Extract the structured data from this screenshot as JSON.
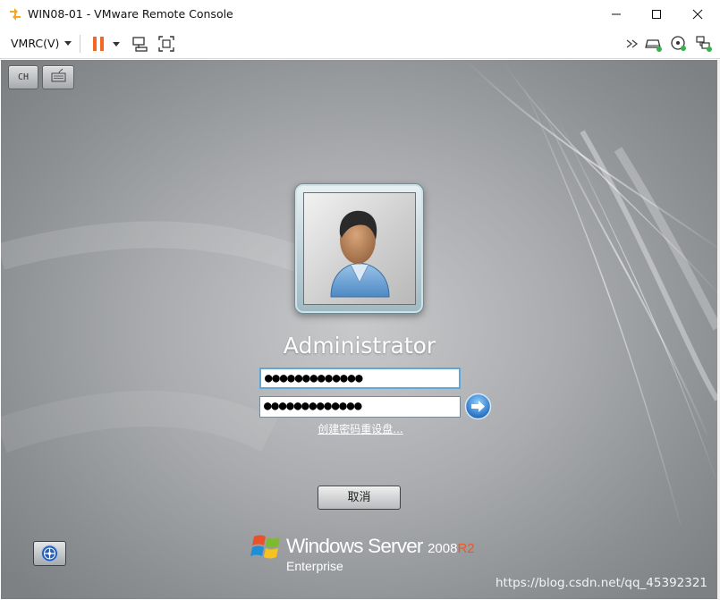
{
  "window": {
    "title": "WIN08-01 - VMware Remote Console",
    "controls": [
      "minimize-icon",
      "maximize-icon",
      "close-icon"
    ]
  },
  "toolbar": {
    "vmrc_menu": "VMRC(V)",
    "left_icons": [
      "pause-icon",
      "dropdown-caret-icon",
      "send-ctrl-alt-del-icon",
      "fullscreen-icon"
    ],
    "right_icons": [
      "double-chevron-icon",
      "hard-disk-icon",
      "cd-rom-icon",
      "network-adapter-icon"
    ],
    "pause_color": "#f06a24"
  },
  "console": {
    "input_language": "CH",
    "user": {
      "name": "Administrator",
      "password_masked": "●●●●●●●●●●●●●",
      "confirm_password_masked": "●●●●●●●●●●●●●"
    },
    "reset_link": "创建密码重设盘...",
    "cancel_label": "取消",
    "brand": {
      "name": "Windows Server",
      "version": "2008",
      "release": "R2",
      "edition": "Enterprise"
    },
    "release_color": "#e85a2a"
  },
  "watermark": "https://blog.csdn.net/qq_45392321"
}
